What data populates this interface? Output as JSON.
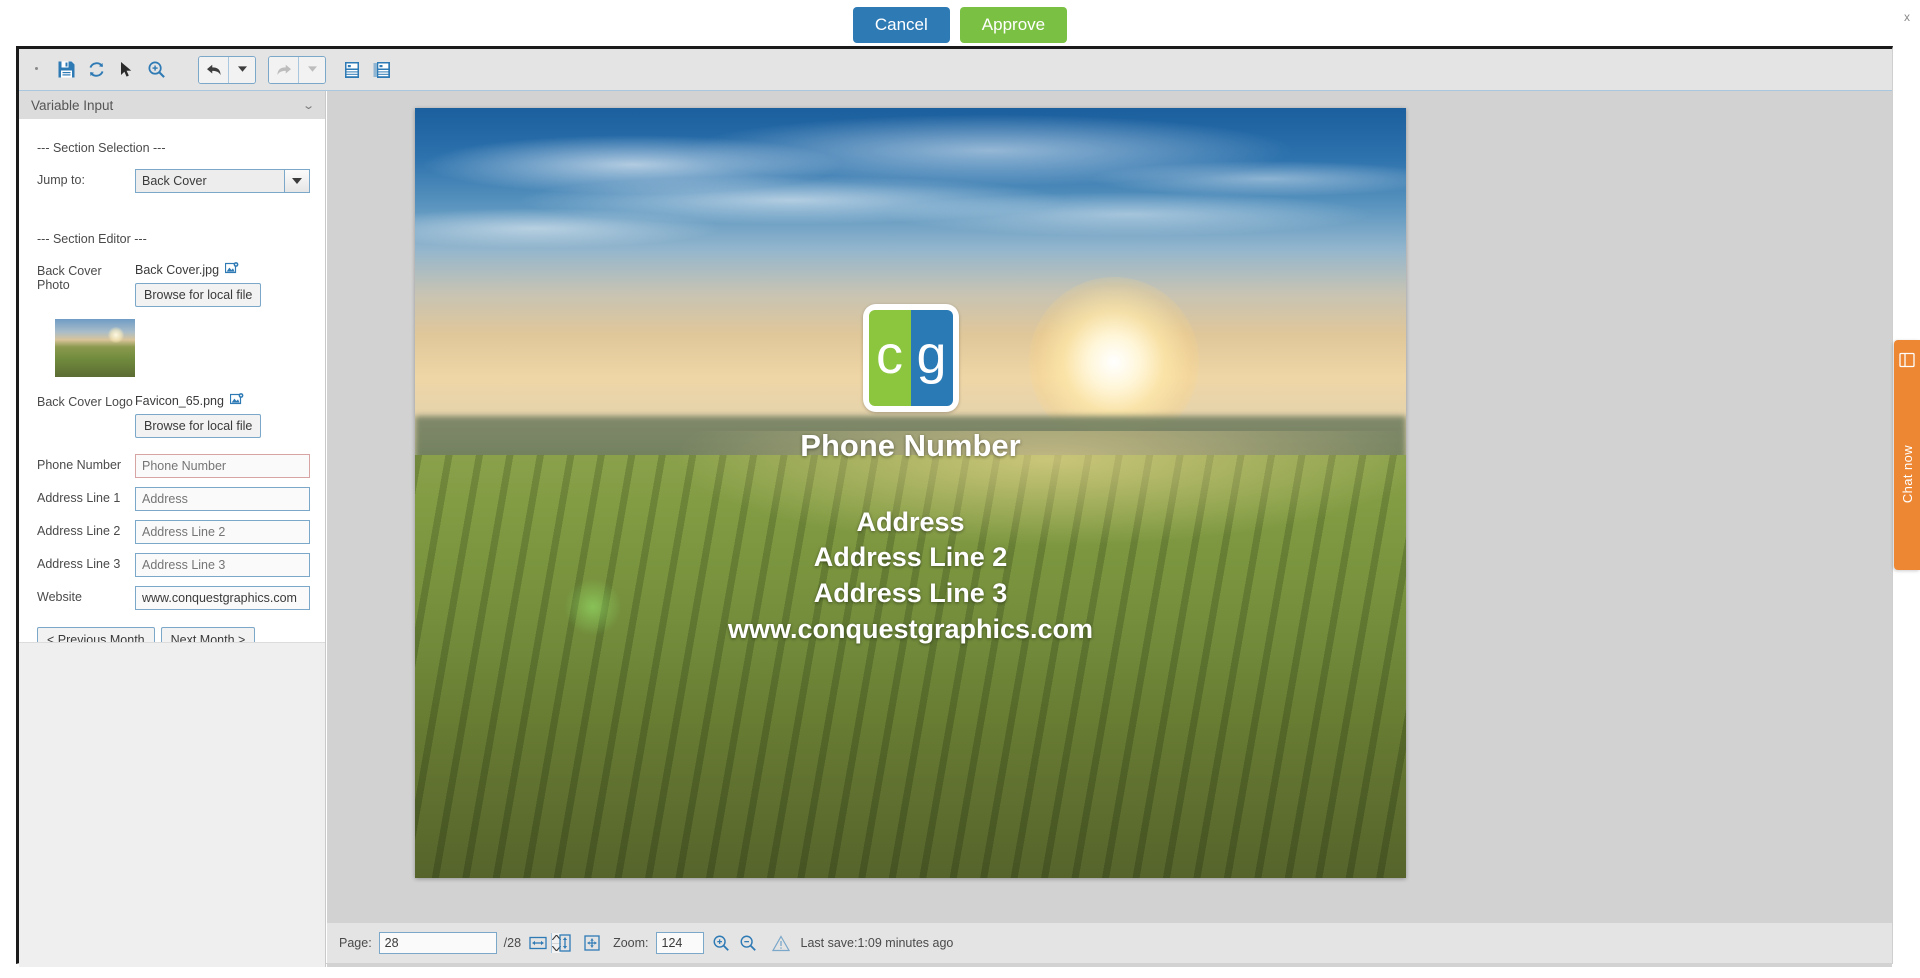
{
  "approval": {
    "cancel_label": "Cancel",
    "approve_label": "Approve",
    "close_label": "x"
  },
  "toolbar": {
    "icons": [
      {
        "name": "save-icon",
        "glyph": "💾"
      },
      {
        "name": "refresh-icon",
        "glyph": "↻"
      },
      {
        "name": "cursor-select-icon",
        "glyph": "➤"
      },
      {
        "name": "zoom-tool-icon",
        "glyph": "🔍"
      }
    ],
    "undo_label": "Undo",
    "undo_dropdown_label": "Undo history",
    "redo_label": "Redo",
    "redo_dropdown_label": "Redo history",
    "single_page_label": "Single page view",
    "spread_page_label": "Spread page view"
  },
  "panel": {
    "title": "Variable Input",
    "collapse_icon": "⌄",
    "section_selection_title": "--- Section Selection ---",
    "jump_to_label": "Jump to:",
    "jump_to_value": "Back Cover",
    "section_editor_title": "--- Section Editor ---",
    "fields": {
      "back_cover_photo_label": "Back Cover Photo",
      "back_cover_photo_file": "Back Cover.jpg",
      "back_cover_logo_label": "Back Cover Logo",
      "back_cover_logo_file": "Favicon_65.png",
      "browse_label": "Browse for local file",
      "phone_number_label": "Phone Number",
      "phone_number_placeholder": "Phone Number",
      "address1_label": "Address Line 1",
      "address1_placeholder": "Address",
      "address2_label": "Address Line 2",
      "address2_placeholder": "Address Line 2",
      "address3_label": "Address Line 3",
      "address3_placeholder": "Address Line 3",
      "website_label": "Website",
      "website_value": "www.conquestgraphics.com"
    },
    "prev_month_label": "< Previous Month",
    "next_month_label": "Next Month >"
  },
  "preview": {
    "logo_left_letter": "c",
    "logo_right_letter": "g",
    "logo_left_color": "#8cc63f",
    "logo_right_color": "#2a7ab5",
    "phone_text": "Phone Number",
    "address_line_1": "Address",
    "address_line_2": "Address Line 2",
    "address_line_3": "Address Line 3",
    "website_text": "www.conquestgraphics.com"
  },
  "status": {
    "page_label": "Page:",
    "page_value": "28",
    "page_total": "/28",
    "fit_width_label": "Fit width",
    "fit_height_label": "Fit height",
    "fit_page_label": "Fit page",
    "zoom_label": "Zoom:",
    "zoom_value": "124",
    "zoom_in_label": "Zoom in",
    "zoom_out_label": "Zoom out",
    "warning_label": "Warning",
    "last_save_text": "Last save:1:09 minutes ago"
  },
  "chat": {
    "label": "Chat now"
  },
  "colors": {
    "cancel_blue": "#2e7ab5",
    "approve_green": "#7ac143",
    "chat_orange": "#ed8733",
    "toolbar_gray": "#e4e4e4",
    "input_border_blue": "#7ba7c9"
  }
}
